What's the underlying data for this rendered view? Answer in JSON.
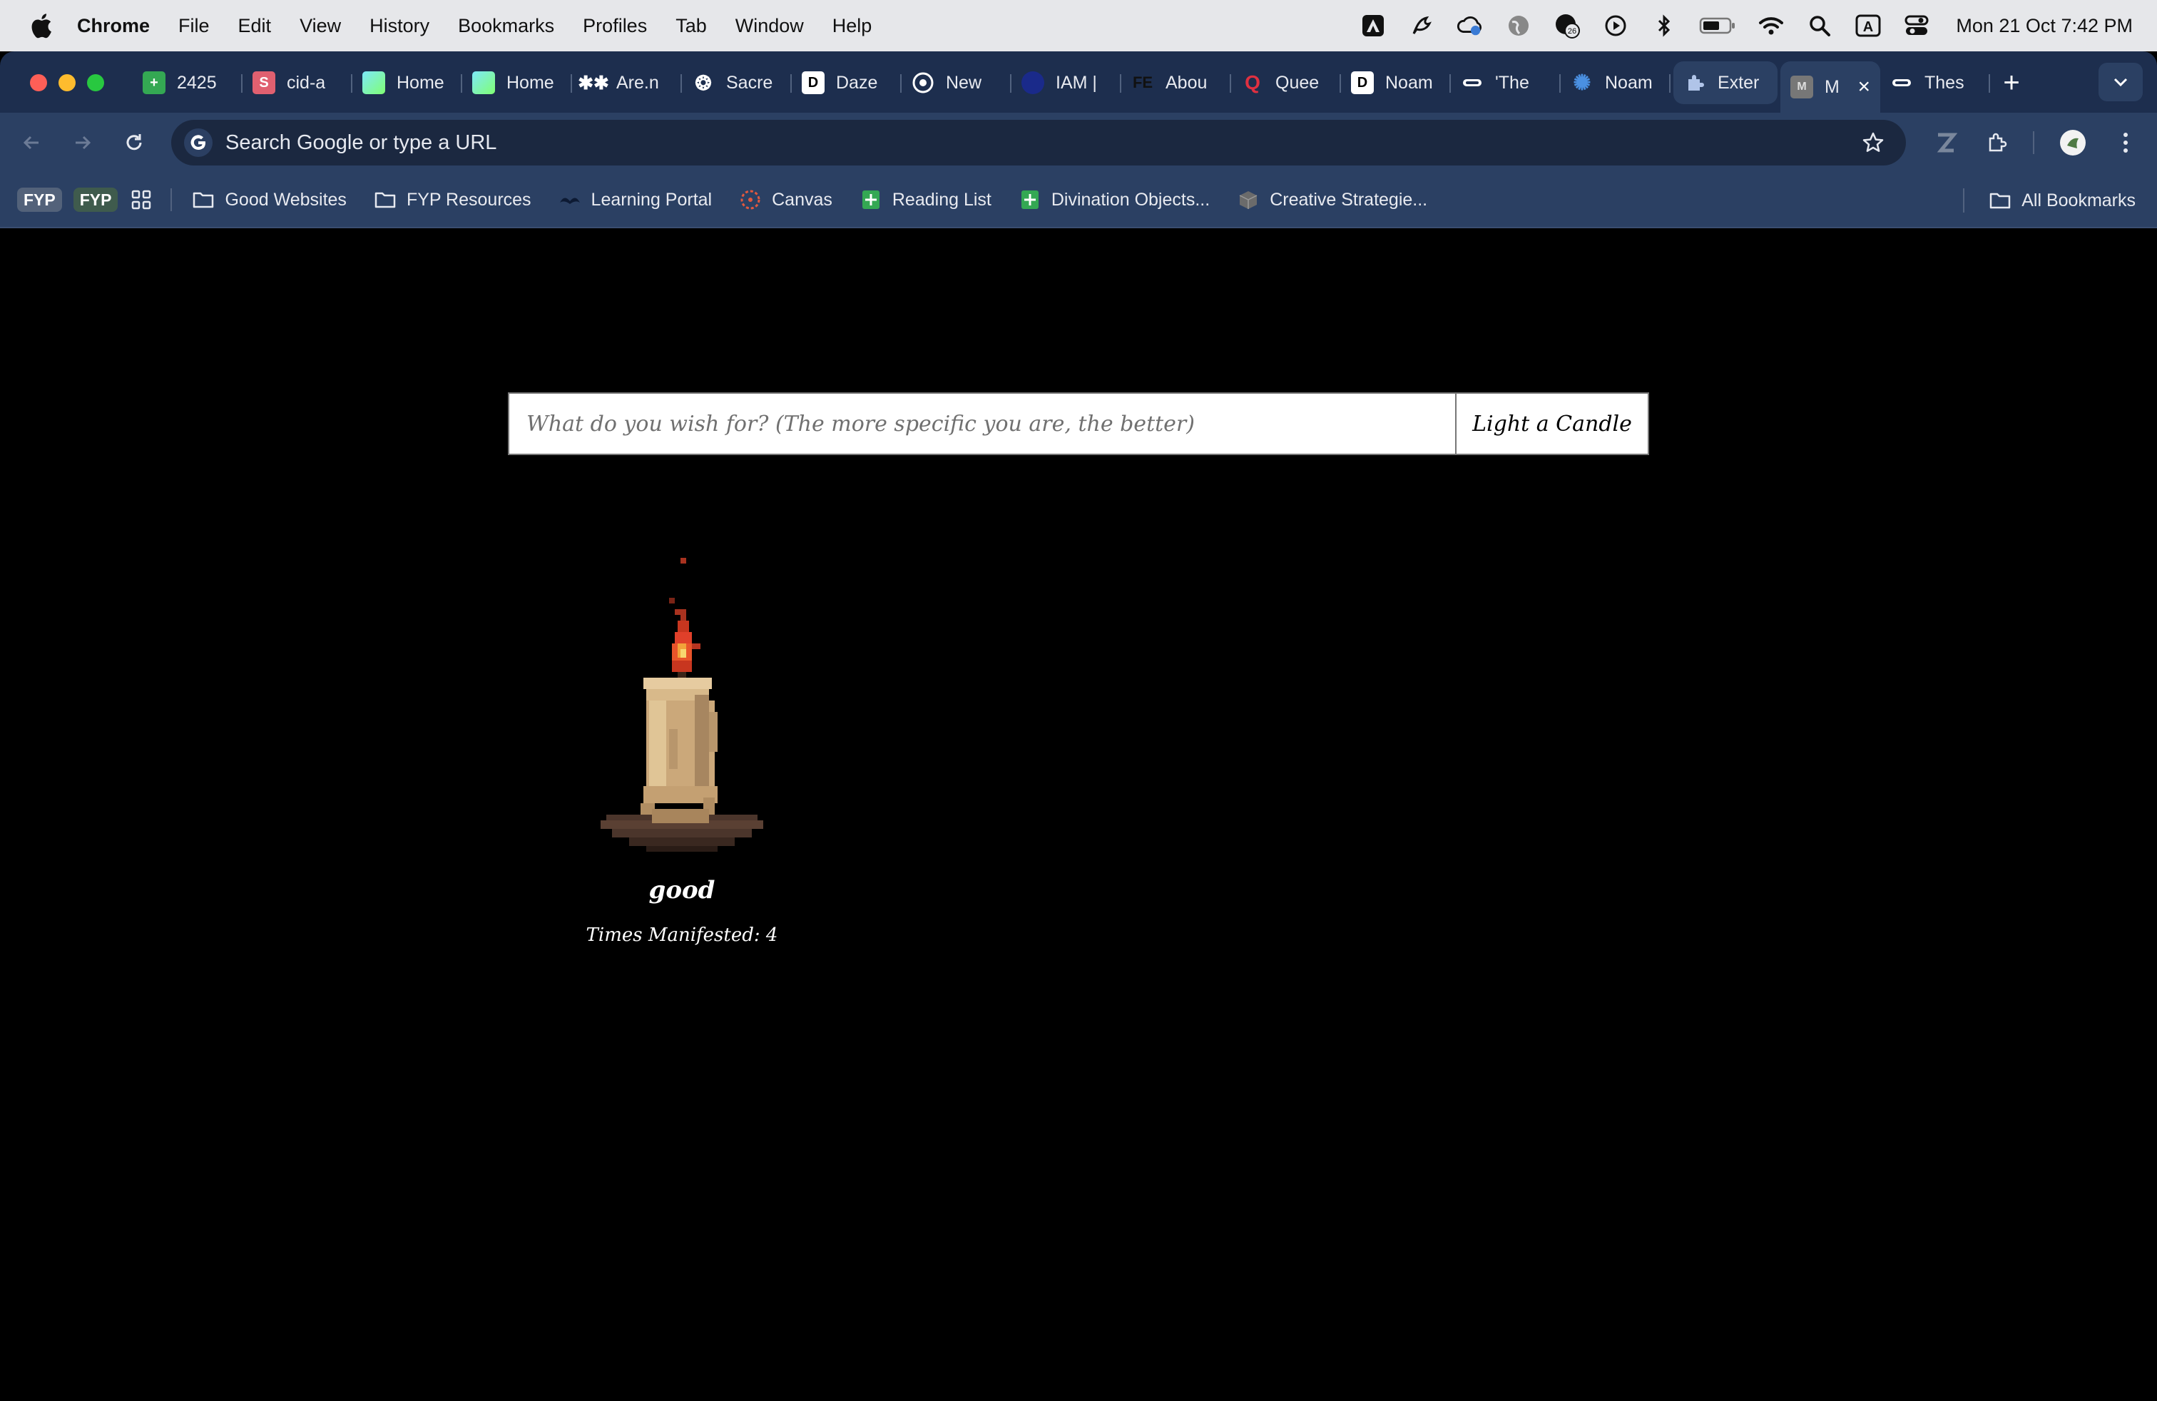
{
  "menubar": {
    "app_name": "Chrome",
    "items": [
      "File",
      "Edit",
      "View",
      "History",
      "Bookmarks",
      "Profiles",
      "Tab",
      "Window",
      "Help"
    ],
    "clock": "Mon 21 Oct  7:42 PM",
    "status_icons": [
      "adobe-icon",
      "stylus-icon",
      "cloud-sync-icon",
      "globe-icon",
      "notifications-icon",
      "play-icon",
      "bluetooth-icon",
      "battery-icon",
      "wifi-icon",
      "spotlight-icon",
      "keyboard-input-icon",
      "control-center-icon"
    ],
    "notification_count": "26",
    "keyboard_input": "A"
  },
  "tabs": [
    {
      "label": "2425",
      "icon": "sheets-icon",
      "color": "#34a853"
    },
    {
      "label": "cid-a",
      "icon": "s-icon",
      "color": "#e06070"
    },
    {
      "label": "Home",
      "icon": "gradient-icon",
      "color": "#5ad1a0"
    },
    {
      "label": "Home",
      "icon": "gradient-icon",
      "color": "#5ad1a0"
    },
    {
      "label": "Are.n",
      "icon": "arena-icon",
      "color": "#ffffff"
    },
    {
      "label": "Sacre",
      "icon": "openai-icon",
      "color": "#ffffff"
    },
    {
      "label": "Daze",
      "icon": "d-icon",
      "color": "#ffffff"
    },
    {
      "label": "New",
      "icon": "chrome-icon",
      "color": "#ffffff"
    },
    {
      "label": "IAM |",
      "icon": "iam-icon",
      "color": "#1a2a8a"
    },
    {
      "label": "Abou",
      "icon": "fe-icon",
      "color": "#111111"
    },
    {
      "label": "Quee",
      "icon": "q-icon",
      "color": "#e03040"
    },
    {
      "label": "Noam",
      "icon": "d-icon",
      "color": "#ffffff"
    },
    {
      "label": "'The",
      "icon": "pill-icon",
      "color": "#ffffff"
    },
    {
      "label": "Noam",
      "icon": "flower-icon",
      "color": "#4a90e2"
    },
    {
      "label": "Exter",
      "icon": "puzzle-icon",
      "color": "#b0c4e8"
    },
    {
      "label": "M",
      "icon": "m-icon",
      "color": "#777777",
      "active": true
    },
    {
      "label": "Thes",
      "icon": "pill-icon",
      "color": "#ffffff"
    }
  ],
  "omnibox": {
    "placeholder": "Search Google or type a URL"
  },
  "bookmarks": {
    "badges": [
      "FYP",
      "FYP"
    ],
    "items": [
      {
        "label": "Good Websites",
        "icon": "folder-icon"
      },
      {
        "label": "FYP Resources",
        "icon": "folder-icon"
      },
      {
        "label": "Learning Portal",
        "icon": "learning-portal-icon"
      },
      {
        "label": "Canvas",
        "icon": "canvas-icon"
      },
      {
        "label": "Reading List",
        "icon": "sheets-icon"
      },
      {
        "label": "Divination Objects...",
        "icon": "sheets-icon"
      },
      {
        "label": "Creative Strategie...",
        "icon": "cube-icon"
      }
    ],
    "all_bookmarks": "All Bookmarks"
  },
  "page": {
    "wish_placeholder": "What do you wish for? (The more specific you are, the better)",
    "button_label": "Light a Candle",
    "candle": {
      "wish": "good",
      "count_label": "Times Manifested: 4"
    }
  },
  "colors": {
    "tabstrip": "#1d2e4e",
    "toolbar": "#2b4063",
    "page_bg": "#000000",
    "flame": "#e0402a",
    "wax": "#d2b48c"
  }
}
